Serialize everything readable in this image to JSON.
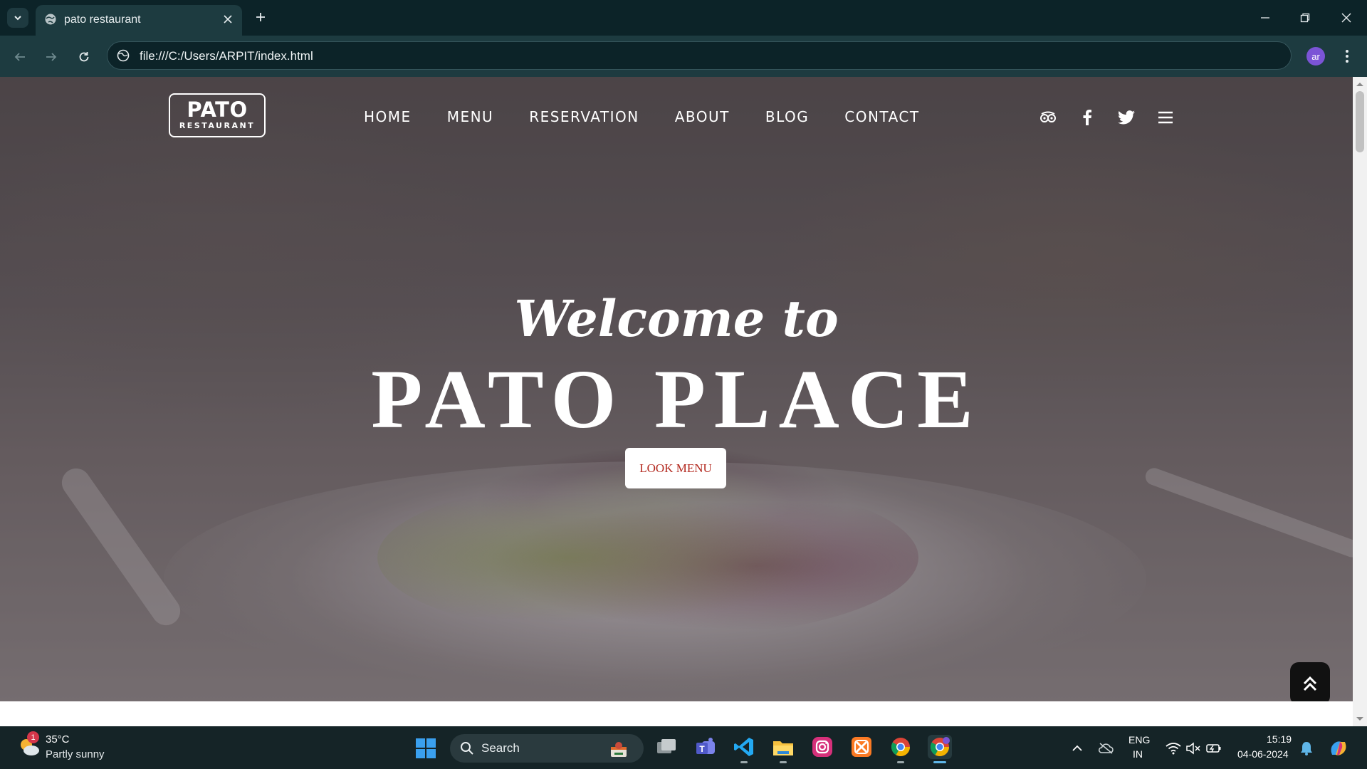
{
  "browser": {
    "tab_title": "pato restaurant",
    "url": "file:///C:/Users/ARPIT/index.html",
    "profile_initials": "ar",
    "icons": {
      "tab_list": "chevron-down-icon",
      "favicon": "globe-icon",
      "tab_close": "close-icon",
      "new_tab": "plus-icon",
      "back": "arrow-left-icon",
      "forward": "arrow-right-icon",
      "reload": "reload-icon",
      "site_info": "info-icon",
      "menu": "kebab-icon",
      "minimize": "minimize-icon",
      "restore": "restore-icon",
      "close": "close-icon"
    }
  },
  "site": {
    "logo": {
      "main": "PATO",
      "sub": "RESTAURANT"
    },
    "nav": [
      "HOME",
      "MENU",
      "RESERVATION",
      "ABOUT",
      "BLOG",
      "CONTACT"
    ],
    "social_icons": [
      "tripadvisor-icon",
      "facebook-icon",
      "twitter-icon",
      "hamburger-menu-icon"
    ],
    "hero": {
      "welcome": "Welcome to",
      "headline": "PATO PLACE",
      "cta": "LOOK MENU"
    },
    "back_to_top_icon": "double-chevron-up-icon"
  },
  "taskbar": {
    "weather": {
      "temp": "35°C",
      "desc": "Partly sunny",
      "badge": "1"
    },
    "search_placeholder": "Search",
    "apps": [
      "task-view-icon",
      "teams-icon",
      "vscode-icon",
      "file-explorer-icon",
      "instagram-icon",
      "xampp-icon",
      "chrome-icon",
      "chrome-profile-icon"
    ],
    "tray": {
      "lang_line1": "ENG",
      "lang_line2": "IN",
      "time": "15:19",
      "date": "04-06-2024"
    }
  },
  "colors": {
    "chrome_dark": "#0c2328",
    "chrome_toolbar": "#1d3b40",
    "cta_text": "#b3281e",
    "taskbar": "#152427"
  }
}
